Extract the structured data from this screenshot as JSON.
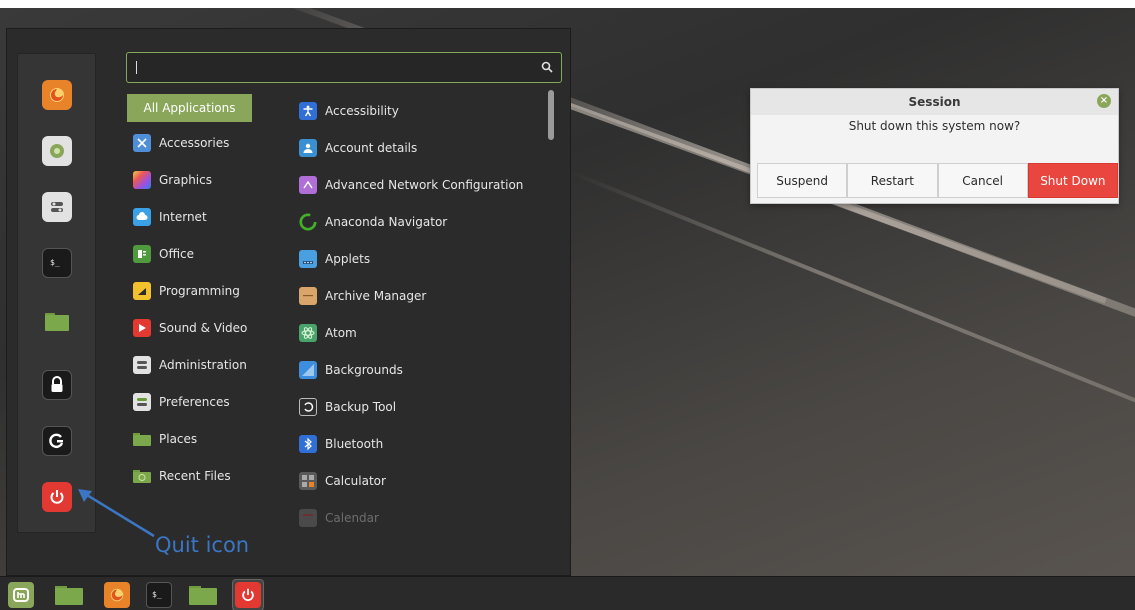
{
  "search": {
    "value": "",
    "placeholder": ""
  },
  "favorites": [
    {
      "name": "firefox-icon",
      "color": "#e8832a"
    },
    {
      "name": "software-manager-icon",
      "color": "#8aa65b"
    },
    {
      "name": "system-settings-icon",
      "color": "#e2e2e2"
    },
    {
      "name": "terminal-icon",
      "color": "#1f1f1f"
    },
    {
      "name": "files-folder-icon",
      "color": "#7aa84a"
    },
    {
      "name": "lock-screen-icon",
      "color": "#1f1f1f"
    },
    {
      "name": "logout-icon",
      "color": "#1f1f1f"
    },
    {
      "name": "quit-icon",
      "color": "#e23a32"
    }
  ],
  "categories": [
    {
      "label": "All Applications",
      "icon": "none",
      "active": true
    },
    {
      "label": "Accessories",
      "icon": "accessories-icon"
    },
    {
      "label": "Graphics",
      "icon": "graphics-icon"
    },
    {
      "label": "Internet",
      "icon": "internet-icon"
    },
    {
      "label": "Office",
      "icon": "office-icon"
    },
    {
      "label": "Programming",
      "icon": "programming-icon"
    },
    {
      "label": "Sound & Video",
      "icon": "sound-video-icon"
    },
    {
      "label": "Administration",
      "icon": "administration-icon"
    },
    {
      "label": "Preferences",
      "icon": "preferences-icon"
    },
    {
      "label": "Places",
      "icon": "places-folder-icon"
    },
    {
      "label": "Recent Files",
      "icon": "recent-files-icon"
    }
  ],
  "apps": [
    {
      "label": "Accessibility",
      "icon": "accessibility-icon"
    },
    {
      "label": "Account details",
      "icon": "account-details-icon"
    },
    {
      "label": "Advanced Network Configuration",
      "icon": "network-config-icon"
    },
    {
      "label": "Anaconda Navigator",
      "icon": "anaconda-icon"
    },
    {
      "label": "Applets",
      "icon": "applets-icon"
    },
    {
      "label": "Archive Manager",
      "icon": "archive-manager-icon"
    },
    {
      "label": "Atom",
      "icon": "atom-icon"
    },
    {
      "label": "Backgrounds",
      "icon": "backgrounds-icon"
    },
    {
      "label": "Backup Tool",
      "icon": "backup-tool-icon"
    },
    {
      "label": "Bluetooth",
      "icon": "bluetooth-icon"
    },
    {
      "label": "Calculator",
      "icon": "calculator-icon"
    },
    {
      "label": "Calendar",
      "icon": "calendar-icon",
      "faded": true
    }
  ],
  "annotation": {
    "text": "Quit icon",
    "color": "#3b76c4"
  },
  "dialog": {
    "title": "Session",
    "message": "Shut down this system now?",
    "buttons": {
      "suspend": "Suspend",
      "restart": "Restart",
      "cancel": "Cancel",
      "shutdown": "Shut Down"
    }
  },
  "taskbar": [
    {
      "name": "taskbar-mint-menu-icon"
    },
    {
      "name": "taskbar-show-desktop-icon"
    },
    {
      "name": "taskbar-firefox-icon"
    },
    {
      "name": "taskbar-terminal-icon"
    },
    {
      "name": "taskbar-files-icon"
    },
    {
      "name": "taskbar-quit-icon"
    }
  ],
  "colors": {
    "accent": "#8aa65b",
    "danger": "#e9463f"
  }
}
